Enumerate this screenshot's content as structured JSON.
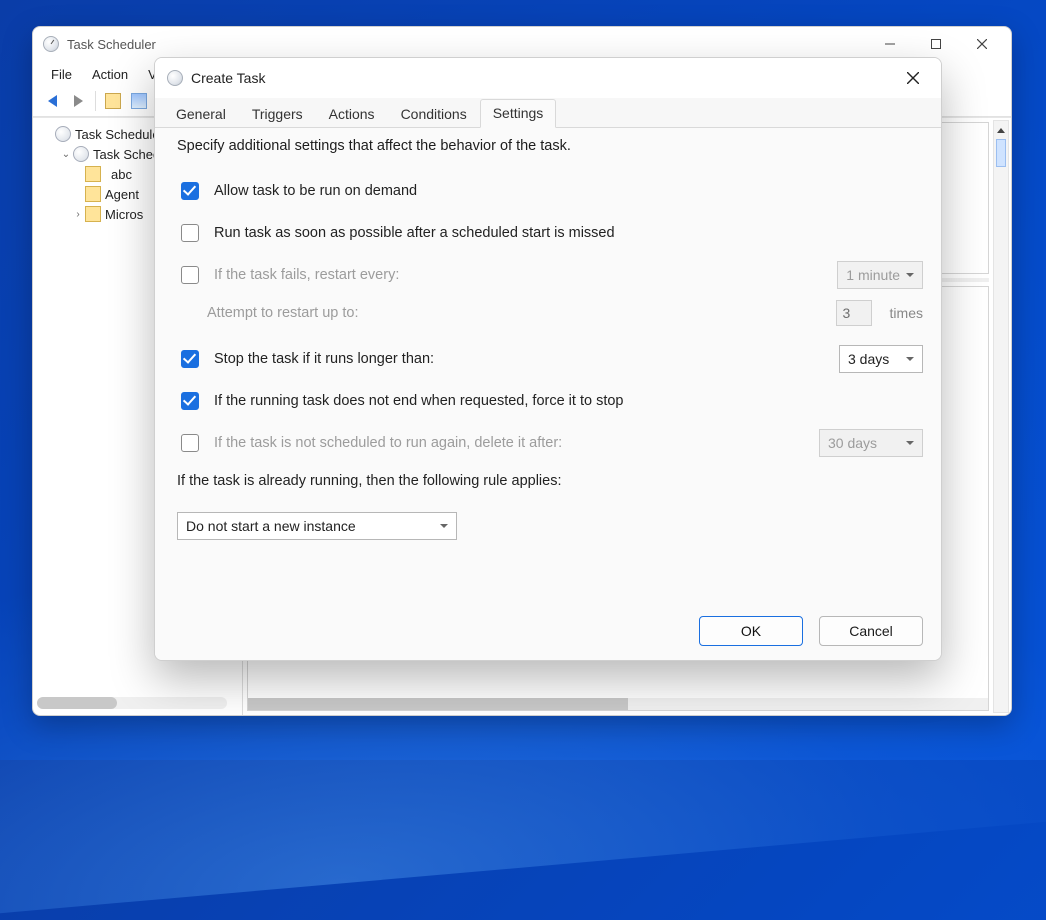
{
  "main_window": {
    "title": "Task Scheduler",
    "menu": {
      "file": "File",
      "action": "Action",
      "view": "V"
    },
    "tree": {
      "root": "Task Scheduler",
      "library": "Task Scheduler",
      "folders": {
        "abc": "abc",
        "agent": "Agent",
        "microsoft": "Micros"
      }
    }
  },
  "dialog": {
    "title": "Create Task",
    "tabs": {
      "general": "General",
      "triggers": "Triggers",
      "actions": "Actions",
      "conditions": "Conditions",
      "settings": "Settings"
    },
    "desc": "Specify additional settings that affect the behavior of the task.",
    "opts": {
      "allow_demand": "Allow task to be run on demand",
      "run_missed": "Run task as soon as possible after a scheduled start is missed",
      "restart_fail": "If the task fails, restart every:",
      "restart_interval": "1 minute",
      "attempt_label": "Attempt to restart up to:",
      "attempt_value": "3",
      "attempt_times": "times",
      "stop_long": "Stop the task if it runs longer than:",
      "stop_long_value": "3 days",
      "force_stop": "If the running task does not end when requested, force it to stop",
      "delete_after": "If the task is not scheduled to run again, delete it after:",
      "delete_after_value": "30 days",
      "already_running": "If the task is already running, then the following rule applies:",
      "rule_value": "Do not start a new instance"
    },
    "buttons": {
      "ok": "OK",
      "cancel": "Cancel"
    }
  }
}
